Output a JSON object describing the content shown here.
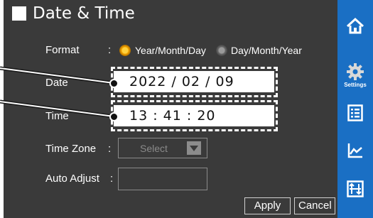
{
  "screen": {
    "title": "Date & Time",
    "format": {
      "label": "Format",
      "colon": ":",
      "options": [
        {
          "label": "Year/Month/Day",
          "selected": true
        },
        {
          "label": "Day/Month/Year",
          "selected": false
        }
      ]
    },
    "date": {
      "label": "Date",
      "value": "2022 / 02 / 09"
    },
    "time": {
      "label": "Time",
      "value": "13 : 41 : 20"
    },
    "time_zone": {
      "label": "Time Zone",
      "colon": ":",
      "selected": "Select"
    },
    "auto_adjust": {
      "label": "Auto Adjust",
      "colon": ":",
      "value": ""
    },
    "buttons": {
      "apply": "Apply",
      "cancel": "Cancel"
    }
  },
  "sidebar": {
    "items": [
      {
        "icon": "home-icon",
        "label": ""
      },
      {
        "icon": "gear-icon",
        "label": "Settings"
      },
      {
        "icon": "list-icon",
        "label": ""
      },
      {
        "icon": "chart-icon",
        "label": ""
      },
      {
        "icon": "adjust-icon",
        "label": ""
      }
    ]
  },
  "colors": {
    "screen_background": "#3a3a3a",
    "sidebar": "#1a6fc4",
    "radio_selected": "#f5a500"
  }
}
